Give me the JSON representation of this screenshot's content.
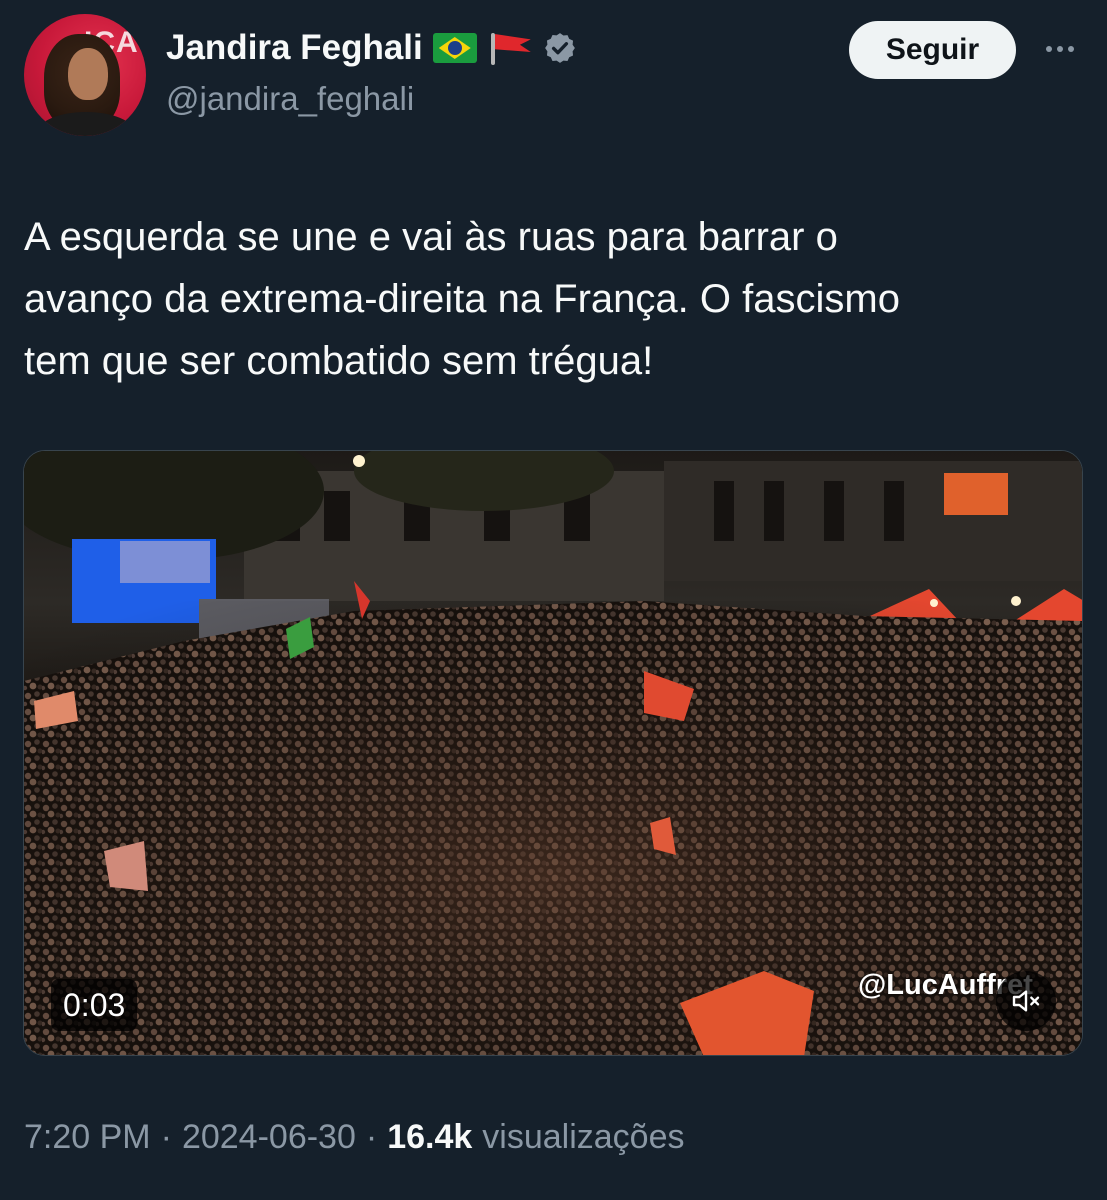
{
  "author": {
    "display_name": "Jandira Feghali",
    "handle": "@jandira_feghali",
    "flags": [
      "brazil-flag-icon",
      "red-flag-icon"
    ],
    "verified_icon": "verified-badge-icon",
    "avatar_text": "ICA"
  },
  "actions": {
    "follow_label": "Seguir",
    "more_icon": "more-icon"
  },
  "tweet": {
    "text_lines": [
      "A esquerda se une e vai às ruas para barrar o",
      "avanço da extrema-direita na França. O fascismo",
      "tem que ser combatido sem trégua!"
    ]
  },
  "media": {
    "type": "video",
    "duration": "0:03",
    "watermark": "@LucAuffret",
    "mute_icon": "speaker-muted-icon"
  },
  "meta": {
    "time": "7:20 PM",
    "separator": "·",
    "date": "2024-06-30",
    "views_count": "16.4k",
    "views_label": "visualizações"
  },
  "colors": {
    "background": "#15202b",
    "text_primary": "#f7f9f9",
    "text_secondary": "#8b98a5",
    "verified_badge": "#8b98a5",
    "follow_button_bg": "#eff3f4"
  }
}
